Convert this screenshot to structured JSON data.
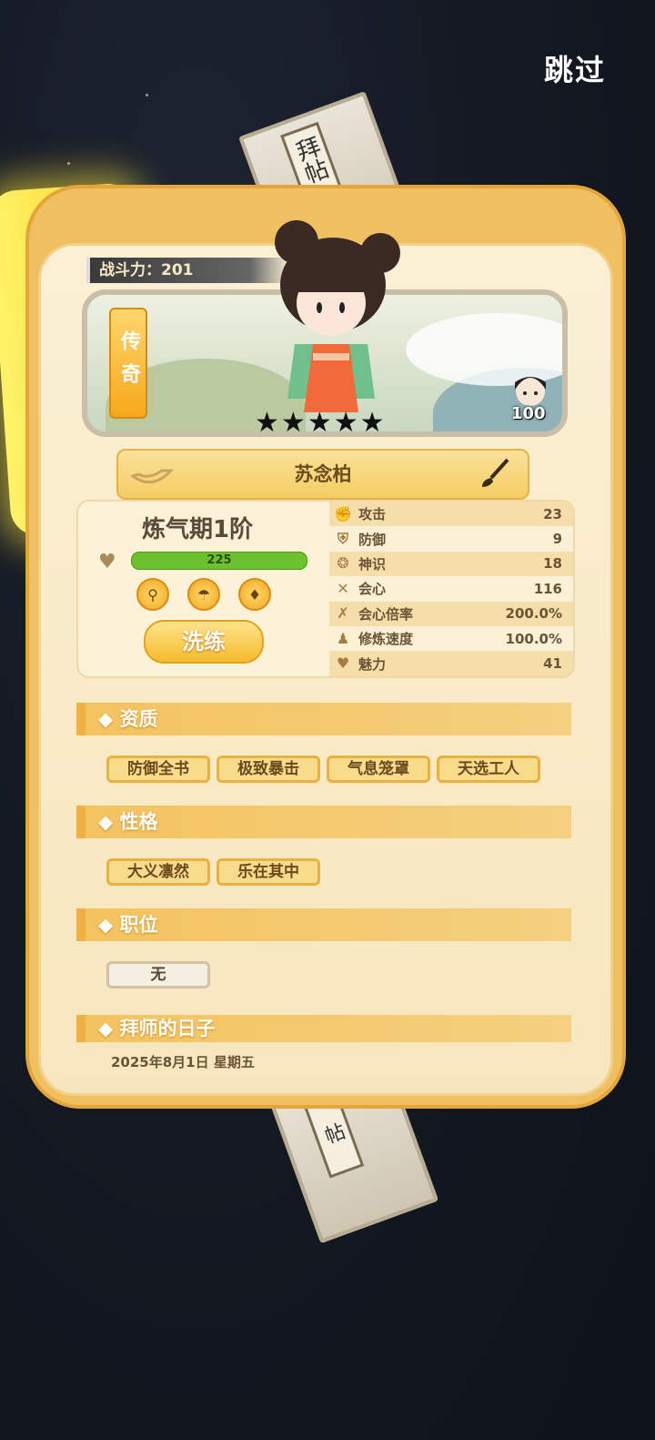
{
  "top_bar": {
    "skip_label": "跳过"
  },
  "scroll": {
    "top_text": "拜帖",
    "bottom_text": "帖"
  },
  "card": {
    "power_label": "战斗力：201",
    "rarity_label": "传奇",
    "star_count": 5,
    "star_glyph": "★",
    "mini_level": "100",
    "name": "苏念柏",
    "realm": "炼气期1阶",
    "hp": "225",
    "hp_fraction": 1.0,
    "refine_label": "洗练",
    "skills": [
      {
        "icon": "fan-icon"
      },
      {
        "icon": "umbrella-icon"
      },
      {
        "icon": "flame-icon"
      }
    ],
    "stats": [
      {
        "icon": "fist-icon",
        "label": "攻击",
        "value": "23"
      },
      {
        "icon": "shield-icon",
        "label": "防御",
        "value": "9"
      },
      {
        "icon": "spirit-icon",
        "label": "神识",
        "value": "18"
      },
      {
        "icon": "cross-swords-icon",
        "label": "会心",
        "value": "116"
      },
      {
        "icon": "crit-rate-icon",
        "label": "会心倍率",
        "value": "200.0%"
      },
      {
        "icon": "meditate-icon",
        "label": "修炼速度",
        "value": "100.0%"
      },
      {
        "icon": "heart-icon",
        "label": "魅力",
        "value": "41"
      }
    ]
  },
  "sections": {
    "aptitude": {
      "title": "◆ 资质",
      "tags": [
        "防御全书",
        "极致暴击",
        "气息笼罩",
        "天选工人"
      ]
    },
    "personality": {
      "title": "◆ 性格",
      "tags": [
        "大义凛然",
        "乐在其中"
      ]
    },
    "position": {
      "title": "◆ 职位",
      "tags": [
        "无"
      ]
    },
    "apprentice_date": {
      "title": "◆ 拜师的日子",
      "date": "2025年8月1日 星期五"
    }
  },
  "colors": {
    "card": "#f0c060",
    "hp_bar": "#6bc12e",
    "accent": "#f5bb2c"
  }
}
